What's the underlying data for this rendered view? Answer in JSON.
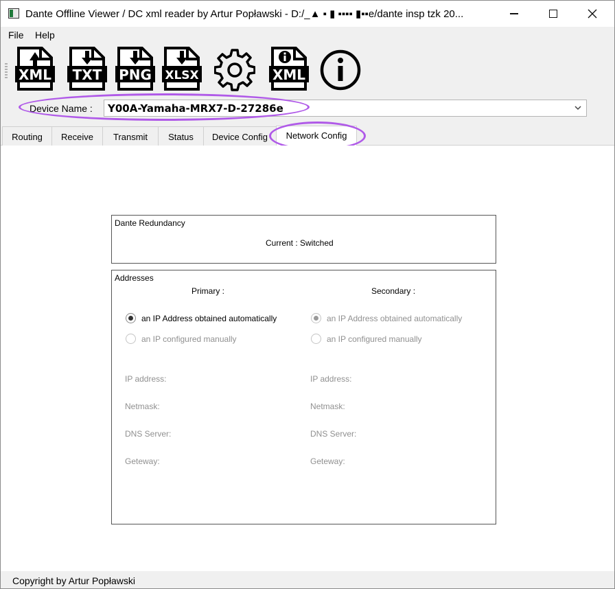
{
  "window": {
    "title": "Dante Offline Viewer / DC xml reader by Artur Popławski - D:/_▲ ▪ ▮ ▪▪▪▪ ▮▪▪e/dante insp tzk 20..."
  },
  "menu": {
    "file": "File",
    "help": "Help"
  },
  "toolbar": {
    "buttons": [
      {
        "icon": "xml-upload-icon",
        "label": "XML"
      },
      {
        "icon": "txt-download-icon",
        "label": "TXT"
      },
      {
        "icon": "png-download-icon",
        "label": "PNG"
      },
      {
        "icon": "xlsx-download-icon",
        "label": "XLSX"
      },
      {
        "icon": "gear-icon",
        "label": ""
      },
      {
        "icon": "xml-info-icon",
        "label": "XML"
      },
      {
        "icon": "info-icon",
        "label": ""
      }
    ]
  },
  "device": {
    "label": "Device Name :",
    "value": "Y00A-Yamaha-MRX7-D-27286e"
  },
  "tabs": [
    {
      "label": "Routing"
    },
    {
      "label": "Receive"
    },
    {
      "label": "Transmit"
    },
    {
      "label": "Status"
    },
    {
      "label": "Device Config"
    },
    {
      "label": "Network Config",
      "active": true
    }
  ],
  "redundancy": {
    "title": "Dante Redundancy",
    "current": "Current : Switched"
  },
  "addresses": {
    "title": "Addresses",
    "primary": {
      "heading": "Primary :",
      "auto_label": "an IP Address obtained automatically",
      "manual_label": "an IP configured manually",
      "ip_label": "IP address:",
      "netmask_label": "Netmask:",
      "dns_label": "DNS Server:",
      "gateway_label": "Geteway:"
    },
    "secondary": {
      "heading": "Secondary :",
      "auto_label": "an IP Address obtained automatically",
      "manual_label": "an IP configured manually",
      "ip_label": "IP address:",
      "netmask_label": "Netmask:",
      "dns_label": "DNS Server:",
      "gateway_label": "Geteway:"
    }
  },
  "statusbar": {
    "text": "Copyright by Artur Popławski"
  },
  "colors": {
    "highlight": "#b05ae8",
    "chrome": "#f0f0f0"
  }
}
